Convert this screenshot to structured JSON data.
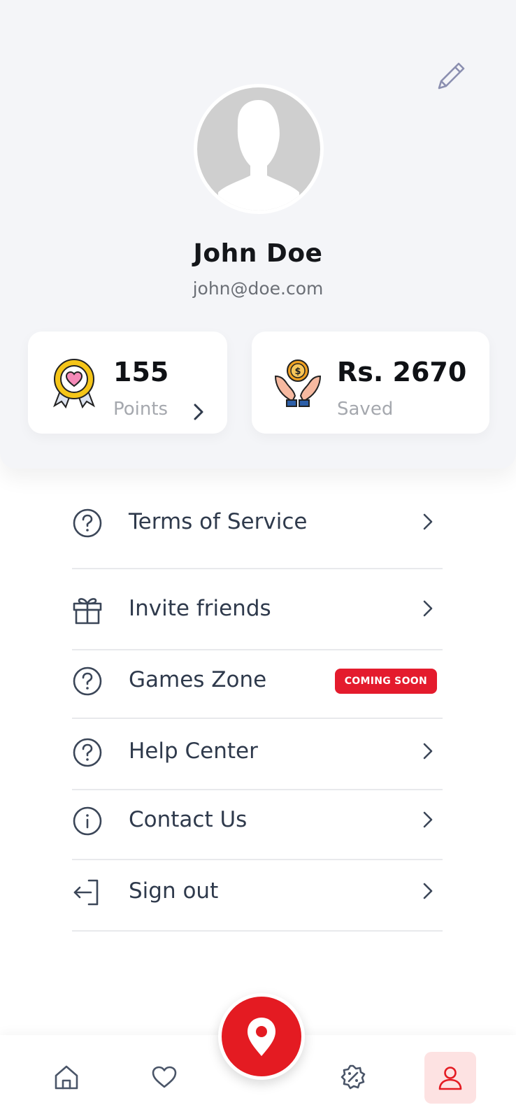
{
  "profile": {
    "name": "John Doe",
    "email": "john@doe.com"
  },
  "stats": {
    "points": {
      "value": "155",
      "label": "Points",
      "icon": "award-badge-heart-icon"
    },
    "saved": {
      "value": "Rs. 2670",
      "label": "Saved",
      "icon": "hands-coin-icon"
    }
  },
  "menu": {
    "items": [
      {
        "label": "Terms of Service",
        "icon": "question-circle-icon"
      },
      {
        "label": "Invite friends",
        "icon": "gift-icon"
      },
      {
        "label": "Games Zone",
        "icon": "question-circle-icon",
        "badge": "COMING SOON"
      },
      {
        "label": "Help Center",
        "icon": "question-circle-icon"
      },
      {
        "label": "Contact Us",
        "icon": "info-circle-icon"
      },
      {
        "label": "Sign out",
        "icon": "sign-out-icon"
      }
    ]
  },
  "nav": {
    "items": [
      "home-icon",
      "heart-icon",
      "location-pin-icon",
      "discount-badge-icon",
      "user-icon"
    ],
    "active": "user-icon"
  },
  "colors": {
    "accent": "#e41b22",
    "header_bg": "#f4f5f8",
    "active_nav_bg": "#fde2e2",
    "text_dark": "#2f3a4c"
  }
}
